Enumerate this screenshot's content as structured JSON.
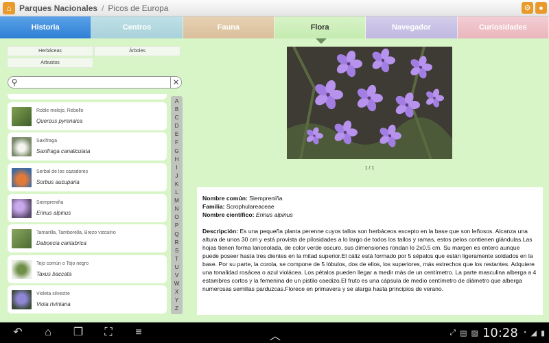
{
  "appbar": {
    "title": "Parques Nacionales",
    "separator": "/",
    "crumb": "Picos de Europa"
  },
  "tabs": [
    {
      "label": "Historia"
    },
    {
      "label": "Centros"
    },
    {
      "label": "Fauna"
    },
    {
      "label": "Flora"
    },
    {
      "label": "Navegador"
    },
    {
      "label": "Curiosidades"
    }
  ],
  "filters": [
    {
      "label": "Herbáceas"
    },
    {
      "label": "Árboles"
    },
    {
      "label": "Arbustos"
    }
  ],
  "search": {
    "value": "",
    "placeholder": ""
  },
  "list": [
    {
      "common": "Roble melojo, Rebollo",
      "scientific": "Quercus pyrenaica",
      "thumb_color": "#5c7d3a"
    },
    {
      "common": "Saxífraga",
      "scientific": "Saxifraga canaliculata",
      "thumb_color": "#cfd8c8"
    },
    {
      "common": "Serbal de los cazadores",
      "scientific": "Sorbus aucuparia",
      "thumb_color": "#c8693a"
    },
    {
      "common": "Siempreniña",
      "scientific": "Erinus alpinus",
      "thumb_color": "#a98ad0"
    },
    {
      "common": "Tamarilla, Tamborella, Brezo vizcaíno",
      "scientific": "Daboecia cantabrica",
      "thumb_color": "#6a8b45"
    },
    {
      "common": "Tejo común o Tejo negro",
      "scientific": "Taxus baccata",
      "thumb_color": "#4c6b34"
    },
    {
      "common": "Violeta silvestre",
      "scientific": "Viola riviniana",
      "thumb_color": "#7d73c6"
    }
  ],
  "alphabet": [
    "A",
    "B",
    "C",
    "D",
    "E",
    "F",
    "G",
    "H",
    "I",
    "J",
    "K",
    "L",
    "M",
    "N",
    "O",
    "P",
    "Q",
    "R",
    "S",
    "T",
    "U",
    "V",
    "W",
    "X",
    "Y",
    "Z"
  ],
  "gallery": {
    "counter": "1 / 1"
  },
  "detail": {
    "common_label": "Nombre común:",
    "common_value": "Siempreniña",
    "family_label": "Familia:",
    "family_value": "Scrophulareaceae",
    "sci_label": "Nombre científico:",
    "sci_value": "Erinus alpinus",
    "desc_label": "Descripción:",
    "desc_text": "Es una pequeña planta perenne cuyos tallos son herbáceos excepto en la base que son leñosos. Alcanza una altura de unos 30 cm y está provista de pilosidades a lo largo de todos los tallos y ramas, estos pelos contienen glándulas.Las hojas tienen forma lanceolada, de color verde oscuro, sus dimensiones rondan lo 2x0.5 cm. Su margen es entero aunque puede poseer hasta tres dientes en la mitad superior.El cáliz está formado por 5 sépalos que están ligeramente soldados en la base. Por su parte, la corola, se compone de 5 lóbulos, dos de ellos, los superiores, más estrechos que los restantes. Adquiere una tonalidad rosácea o azul violácea. Los pétalos pueden llegar a medir más de un centímetro. La parte masculina alberga a 4 estambres cortos y la femenina de un pistilo caedizo.El fruto es una cápsula de medio centímetro de diámetro que alberga numerosas semillas parduzcas.Florece en primavera y se alarga hasta principios de verano."
  },
  "sysbar": {
    "time": "10:28"
  }
}
